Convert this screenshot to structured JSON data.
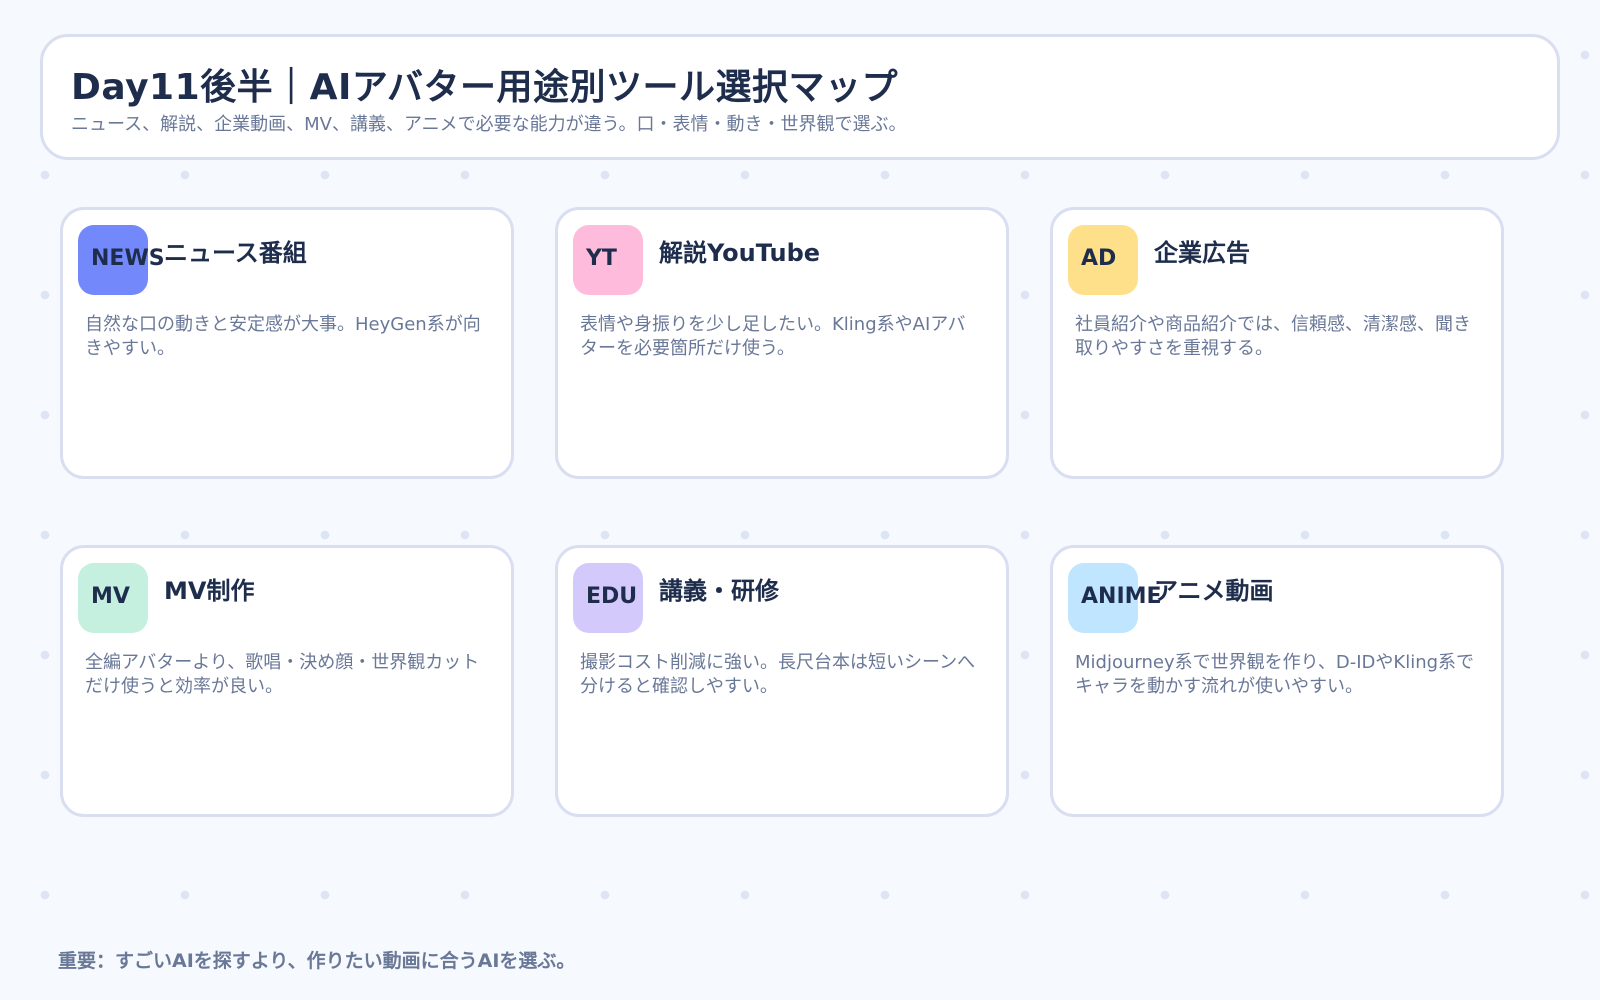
{
  "header": {
    "title": "Day11後半｜AIアバター用途別ツール選択マップ",
    "subtitle": "ニュース、解説、企業動画、MV、講義、アニメで必要な能力が違う。口・表情・動き・世界観で選ぶ。"
  },
  "cards": [
    {
      "badge": "NEWS",
      "badge_color": "#7388fb",
      "title": "ニュース番組",
      "description": "自然な口の動きと安定感が大事。HeyGen系が向きやすい。"
    },
    {
      "badge": "YT",
      "badge_color": "#ffbbdc",
      "title": "解説YouTube",
      "description": "表情や身振りを少し足したい。Kling系やAIアバターを必要箇所だけ使う。"
    },
    {
      "badge": "AD",
      "badge_color": "#ffe08a",
      "title": "企業広告",
      "description": "社員紹介や商品紹介では、信頼感、清潔感、聞き取りやすさを重視する。"
    },
    {
      "badge": "MV",
      "badge_color": "#c5efdf",
      "title": "MV制作",
      "description": "全編アバターより、歌唱・決め顔・世界観カットだけ使うと効率が良い。"
    },
    {
      "badge": "EDU",
      "badge_color": "#d4c9fb",
      "title": "講義・研修",
      "description": "撮影コスト削減に強い。長尺台本は短いシーンへ分けると確認しやすい。"
    },
    {
      "badge": "ANIME",
      "badge_color": "#bfe5ff",
      "title": "アニメ動画",
      "description": "Midjourney系で世界観を作り、D-IDやKling系でキャラを動かす流れが使いやすい。"
    }
  ],
  "footer": {
    "note": "重要：すごいAIを探すより、作りたい動画に合うAIを選ぶ。"
  }
}
